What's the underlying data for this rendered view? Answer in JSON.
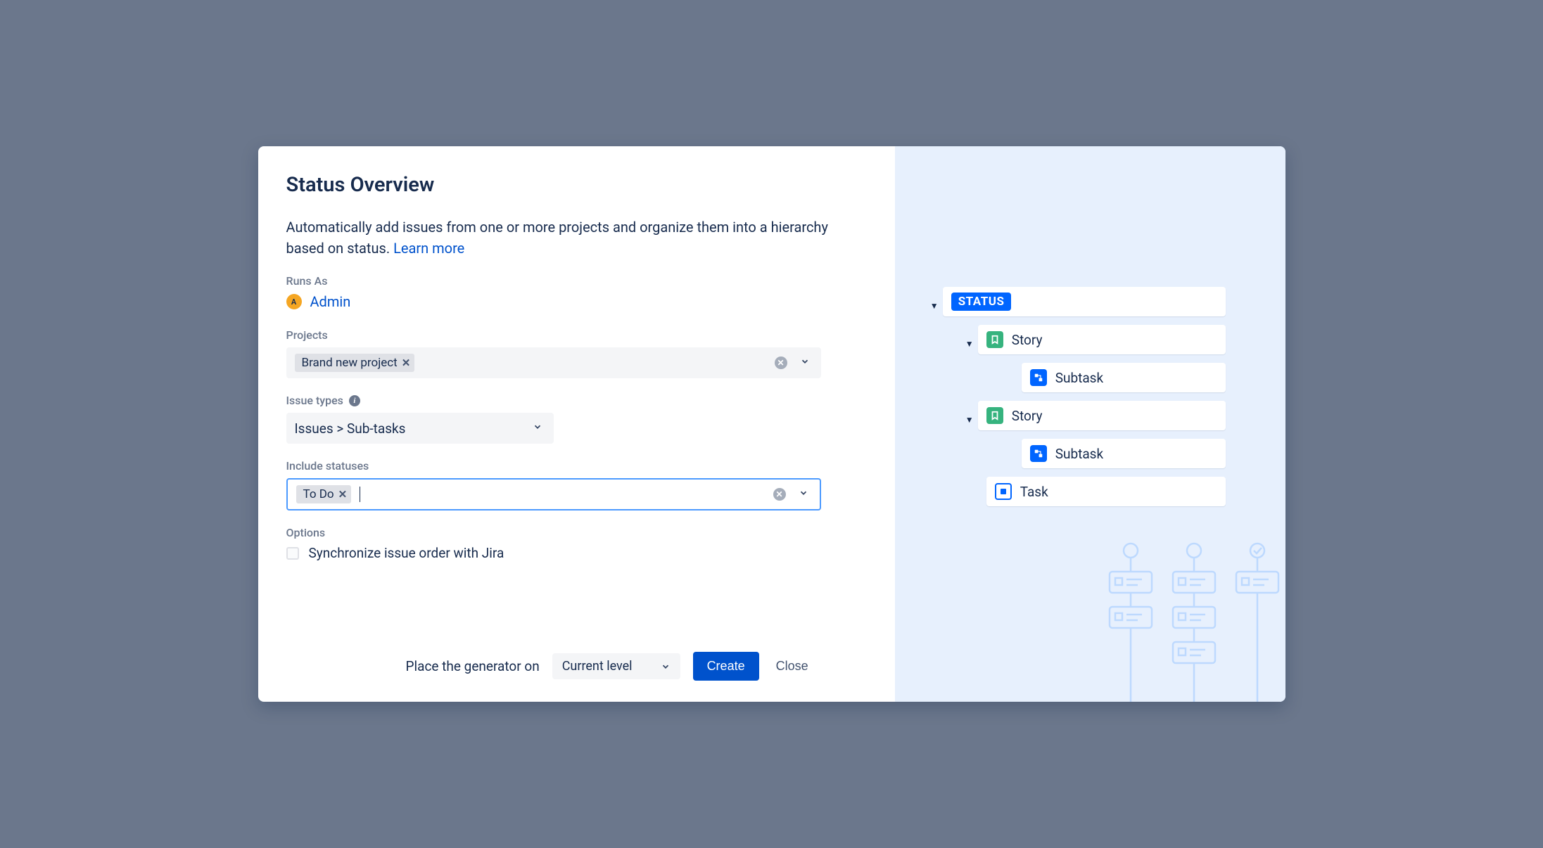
{
  "title": "Status Overview",
  "description": "Automatically add issues from one or more projects and organize them into a hierarchy based on status.",
  "learn_more": "Learn more",
  "labels": {
    "runs_as": "Runs As",
    "projects": "Projects",
    "issue_types": "Issue types",
    "include_statuses": "Include statuses",
    "options": "Options"
  },
  "runs_as": {
    "avatar_initial": "A",
    "name": "Admin"
  },
  "projects": {
    "selected": [
      {
        "label": "Brand new project"
      }
    ]
  },
  "issue_types": {
    "value": "Issues > Sub-tasks"
  },
  "include_statuses": {
    "selected": [
      {
        "label": "To Do"
      }
    ]
  },
  "options": {
    "sync_label": "Synchronize issue order with Jira",
    "sync_checked": false
  },
  "footer": {
    "place_label": "Place the generator on",
    "level_value": "Current level",
    "create": "Create",
    "close": "Close"
  },
  "preview": {
    "status_label": "STATUS",
    "items": [
      {
        "type": "story",
        "label": "Story",
        "children": [
          {
            "type": "subtask",
            "label": "Subtask"
          }
        ]
      },
      {
        "type": "story",
        "label": "Story",
        "children": [
          {
            "type": "subtask",
            "label": "Subtask"
          }
        ]
      },
      {
        "type": "task",
        "label": "Task"
      }
    ]
  }
}
